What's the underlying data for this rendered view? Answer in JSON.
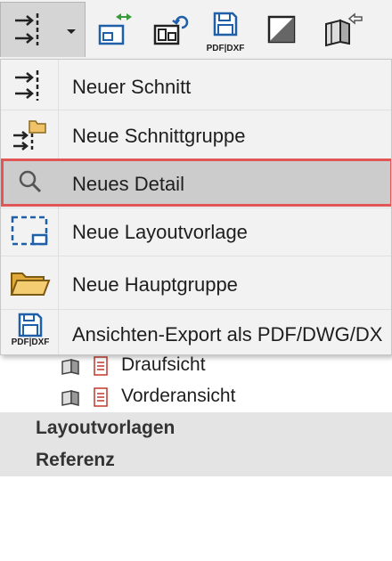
{
  "toolbar": {
    "export_label": "PDF|DXF"
  },
  "menu": {
    "items": [
      {
        "label": "Neuer Schnitt",
        "icon": "new-section-icon"
      },
      {
        "label": "Neue Schnittgruppe",
        "icon": "new-section-group-icon"
      },
      {
        "label": "Neues Detail",
        "icon": "magnifier-icon",
        "selected": true
      },
      {
        "label": "Neue Layoutvorlage",
        "icon": "layout-template-icon"
      },
      {
        "label": "Neue Hauptgruppe",
        "icon": "folder-icon"
      },
      {
        "label": "Ansichten-Export als PDF/DWG/DX",
        "icon": "pdf-dxf-save-icon",
        "icon_caption": "PDF|DXF"
      }
    ]
  },
  "tree": {
    "rows": [
      {
        "label": "Draufsicht"
      },
      {
        "label": "Vorderansicht"
      }
    ],
    "sections": [
      {
        "label": "Layoutvorlagen"
      },
      {
        "label": "Referenz"
      }
    ]
  },
  "colors": {
    "highlight_border": "#e15757",
    "selected_bg": "#cccccc",
    "menu_bg": "#f2f2f2",
    "section_bg": "#e4e4e4",
    "accent_blue": "#1f5fa8",
    "accent_green": "#3a9a3a"
  }
}
